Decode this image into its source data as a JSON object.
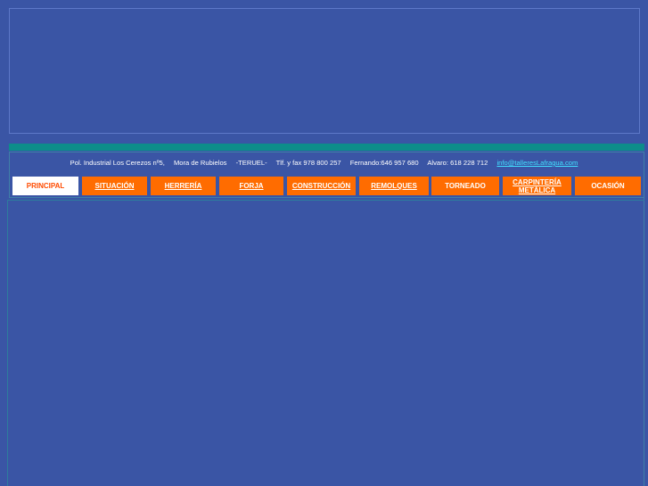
{
  "contact": {
    "address": "Pol. Industrial  Los Cerezos  nº5,",
    "town": "Mora de Rubielos",
    "province": "-TERUEL-",
    "phone": "Tlf. y fax 978 800 257",
    "fernando": "Fernando:646 957 680",
    "alvaro": "Alvaro: 618 228 712",
    "email": "info@talleresLafragua.com"
  },
  "nav": [
    {
      "label": "PRINCIPAL",
      "active": true
    },
    {
      "label": "SITUACIÓN"
    },
    {
      "label": "HERRERÍA"
    },
    {
      "label": "FORJA"
    },
    {
      "label": "CONSTRUCCIÓN"
    },
    {
      "label": "REMOLQUES"
    },
    {
      "label": "TORNEADO"
    },
    {
      "label": "CARPINTERÍA METÁLICA"
    },
    {
      "label": "OCASIÓN"
    }
  ],
  "colors": {
    "background": "#3a55a5",
    "accent": "#ff6c00",
    "teal": "#0d8d8a",
    "link": "#42e1ff"
  }
}
